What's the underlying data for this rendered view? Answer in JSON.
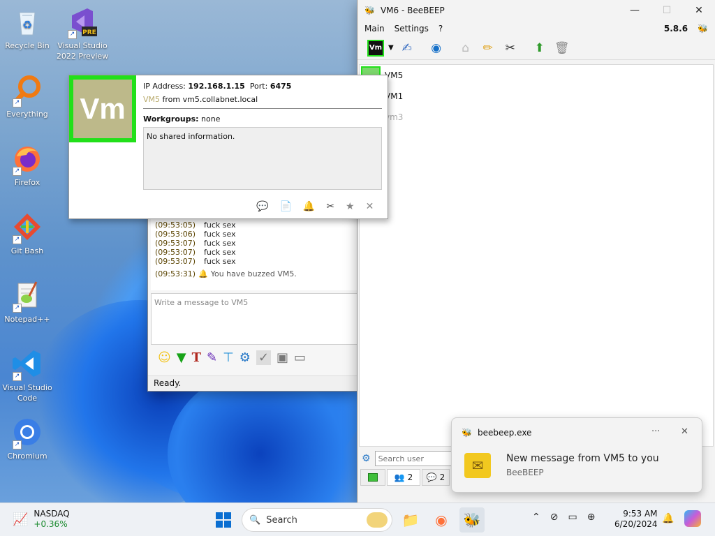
{
  "desktop": {
    "icons": [
      {
        "label": "Recycle Bin",
        "icon": "recycle-bin-icon"
      },
      {
        "label": "Visual Studio 2022 Preview",
        "icon": "visual-studio-preview-icon",
        "badge": "PRE"
      },
      {
        "label": "Everything",
        "icon": "everything-search-icon"
      },
      {
        "label": "Firefox",
        "icon": "firefox-icon"
      },
      {
        "label": "Git Bash",
        "icon": "git-bash-icon"
      },
      {
        "label": "Notepad++",
        "icon": "notepad-plus-plus-icon"
      },
      {
        "label": "Visual Studio Code",
        "icon": "vscode-icon"
      },
      {
        "label": "Chromium",
        "icon": "chromium-icon"
      }
    ]
  },
  "beebeep": {
    "title": "VM6 - BeeBEEP",
    "menu": [
      "Main",
      "Settings",
      "?"
    ],
    "version": "5.8.6",
    "users": [
      {
        "name": "VM5",
        "online": true
      },
      {
        "name": "VM1",
        "online": true
      },
      {
        "name": "vm3",
        "online": false
      }
    ],
    "search_placeholder": "Search user",
    "tabs": [
      {
        "label": "",
        "icon": "users-tab-icon"
      },
      {
        "label": "2",
        "icon": "groups-tab-icon"
      },
      {
        "label": "2",
        "icon": "chats-tab-icon"
      }
    ]
  },
  "popup": {
    "avatar_text": "Vm",
    "ip_label": "IP Address:",
    "ip_value": "192.168.1.15",
    "port_label": "Port:",
    "port_value": "6475",
    "user_name": "VM5",
    "host_text": "from vm5.collabnet.local",
    "workgroups_label": "Workgroups:",
    "workgroups_value": "none",
    "shared_info": "No shared information."
  },
  "chat": {
    "messages": [
      {
        "time": "(09:53:05)",
        "text": "fuck sex"
      },
      {
        "time": "(09:53:06)",
        "text": "fuck sex"
      },
      {
        "time": "(09:53:07)",
        "text": "fuck sex"
      },
      {
        "time": "(09:53:07)",
        "text": "fuck sex"
      },
      {
        "time": "(09:53:07)",
        "text": "fuck sex"
      }
    ],
    "buzz": {
      "time": "(09:53:31)",
      "text": "You have buzzed VM5."
    },
    "input_placeholder": "Write a message to VM5",
    "status": "Ready."
  },
  "notification": {
    "app": "beebeep.exe",
    "title": "New message from VM5 to you",
    "subtitle": "BeeBEEP",
    "more": "···",
    "close": "✕"
  },
  "taskbar": {
    "stock_name": "NASDAQ",
    "stock_change": "+0.36%",
    "search_label": "Search",
    "time": "9:53 AM",
    "date": "6/20/2024"
  },
  "colors": {
    "avatar_border": "#22e01a",
    "avatar_bg": "#bdb98a",
    "accent_blue": "#0067c0",
    "stock_green": "#1a8a2e"
  }
}
